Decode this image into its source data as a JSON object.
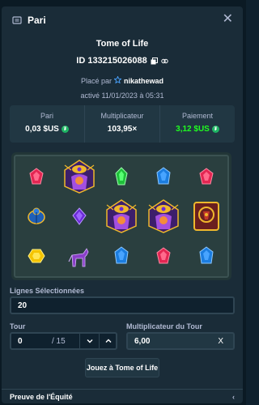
{
  "modal": {
    "title": "Pari",
    "game_name": "Tome of Life",
    "bet_id": "ID 133215026088",
    "placed_by_label": "Placé par",
    "placed_by_user": "nikathewad",
    "activated": "activé 11/01/2023 à 05:31"
  },
  "stats": {
    "bet_label": "Pari",
    "bet_value": "0,03 $US",
    "multiplier_label": "Multiplicateur",
    "multiplier_value": "103,95×",
    "payout_label": "Paiement",
    "payout_value": "3,12 $US",
    "payout_color": "#1fff20"
  },
  "board": {
    "rows": [
      [
        "red-gem",
        "pharaoh-eye",
        "green-gem",
        "blue-gem",
        "red-gem"
      ],
      [
        "blue-scarab",
        "purple-gem",
        "pharaoh-eye",
        "pharaoh-eye",
        "tome"
      ],
      [
        "yellow-gem",
        "jackal",
        "blue-gem",
        "red-gem",
        "blue-gem"
      ]
    ]
  },
  "lines": {
    "label": "Lignes Sélectionnées",
    "value": "20"
  },
  "round": {
    "label": "Tour",
    "value": "0",
    "total": "/ 15"
  },
  "round_multiplier": {
    "label": "Multiplicateur du Tour",
    "value": "6,00",
    "suffix": "X"
  },
  "play_button": "Jouez à Tome of Life",
  "footer": {
    "label": "Preuve de l'Équité"
  }
}
